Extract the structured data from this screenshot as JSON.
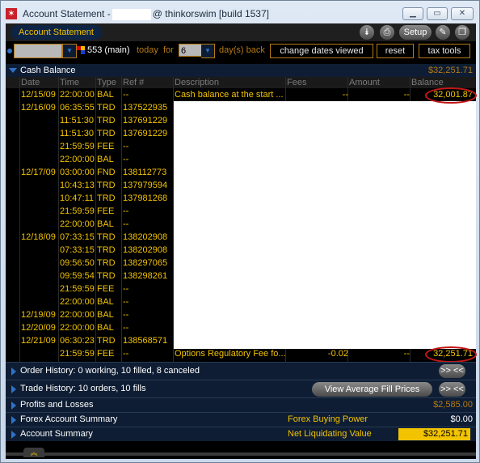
{
  "window": {
    "title_prefix": "Account Statement -",
    "title_suffix": "@ thinkorswim [build 1537]",
    "minimize_icon": "minimize-icon",
    "maximize_icon": "maximize-icon",
    "close_icon": "close-icon"
  },
  "tabbar": {
    "active_tab": "Account Statement",
    "setup_label": "Setup",
    "icons": [
      "collapse-icon",
      "print-icon",
      "pin-icon",
      "detach-icon"
    ]
  },
  "toolbar": {
    "account_value": "",
    "account_label": "553 (main)",
    "today_label": "today",
    "for_label": "for",
    "days_value": "6",
    "days_back_label": "day(s) back",
    "change_dates_label": "change dates viewed",
    "reset_label": "reset",
    "tax_tools_label": "tax tools"
  },
  "cash_balance": {
    "title": "Cash Balance",
    "total": "$32,251.71",
    "columns": [
      "Date",
      "Time",
      "Type",
      "Ref #",
      "Description",
      "Fees",
      "Amount",
      "Balance"
    ],
    "rows": [
      {
        "date": "12/15/09",
        "time": "22:00:00",
        "type": "BAL",
        "ref": "--",
        "desc": "Cash balance at the start ...",
        "fees": "--",
        "amount": "--",
        "balance": "32,001.87"
      },
      {
        "date": "12/16/09",
        "time": "06:35:55",
        "type": "TRD",
        "ref": "137522935"
      },
      {
        "date": "",
        "time": "11:51:30",
        "type": "TRD",
        "ref": "137691229"
      },
      {
        "date": "",
        "time": "11:51:30",
        "type": "TRD",
        "ref": "137691229"
      },
      {
        "date": "",
        "time": "21:59:59",
        "type": "FEE",
        "ref": "--"
      },
      {
        "date": "",
        "time": "22:00:00",
        "type": "BAL",
        "ref": "--"
      },
      {
        "date": "12/17/09",
        "time": "03:00:00",
        "type": "FND",
        "ref": "138112773"
      },
      {
        "date": "",
        "time": "10:43:13",
        "type": "TRD",
        "ref": "137979594"
      },
      {
        "date": "",
        "time": "10:47:11",
        "type": "TRD",
        "ref": "137981268"
      },
      {
        "date": "",
        "time": "21:59:59",
        "type": "FEE",
        "ref": "--"
      },
      {
        "date": "",
        "time": "22:00:00",
        "type": "BAL",
        "ref": "--"
      },
      {
        "date": "12/18/09",
        "time": "07:33:15",
        "type": "TRD",
        "ref": "138202908"
      },
      {
        "date": "",
        "time": "07:33:15",
        "type": "TRD",
        "ref": "138202908"
      },
      {
        "date": "",
        "time": "09:56:50",
        "type": "TRD",
        "ref": "138297065"
      },
      {
        "date": "",
        "time": "09:59:54",
        "type": "TRD",
        "ref": "138298261"
      },
      {
        "date": "",
        "time": "21:59:59",
        "type": "FEE",
        "ref": "--"
      },
      {
        "date": "",
        "time": "22:00:00",
        "type": "BAL",
        "ref": "--"
      },
      {
        "date": "12/19/09",
        "time": "22:00:00",
        "type": "BAL",
        "ref": "--"
      },
      {
        "date": "12/20/09",
        "time": "22:00:00",
        "type": "BAL",
        "ref": "--"
      },
      {
        "date": "12/21/09",
        "time": "06:30:23",
        "type": "TRD",
        "ref": "138568571"
      },
      {
        "date": "",
        "time": "21:59:59",
        "type": "FEE",
        "ref": "--",
        "desc": "Options Regulatory Fee fo...",
        "fees": "-0.02",
        "amount": "--",
        "balance": "32,251.71"
      }
    ]
  },
  "sections": {
    "order_history": "Order History: 0 working, 10 filled, 8 canceled",
    "trade_history": "Trade History: 10 orders, 10 fills",
    "view_avg_fill": "View Average Fill Prices",
    "expand_collapse": ">> <<",
    "pnl": "Profits and Losses",
    "pnl_value": "$2,585.00",
    "forex_summary": "Forex Account Summary",
    "forex_bp_label": "Forex Buying Power",
    "forex_bp_value": "$0.00",
    "account_summary": "Account Summary",
    "nlv_label": "Net Liquidating Value",
    "nlv_value": "$32,251.71"
  },
  "footer": {
    "expand_icon": "chevron-up-double-icon"
  },
  "colors": {
    "accent_yellow": "#f2c300",
    "orange": "#b67a14",
    "blue": "#2f72c9",
    "annotation_red": "#c41616"
  }
}
